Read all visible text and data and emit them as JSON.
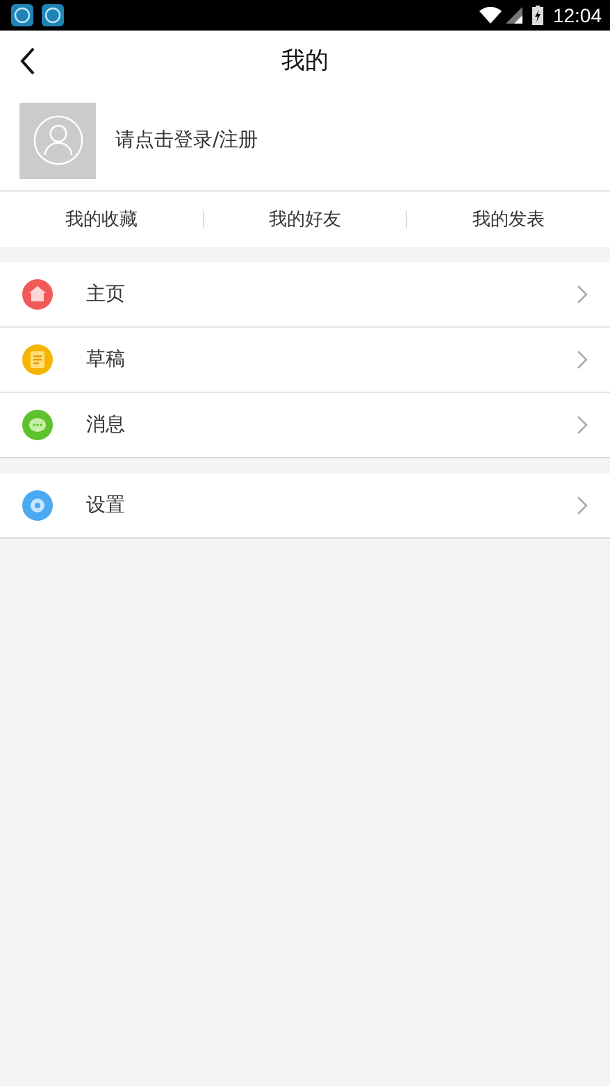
{
  "status_bar": {
    "time": "12:04"
  },
  "header": {
    "title": "我的"
  },
  "profile": {
    "prompt": "请点击登录/注册"
  },
  "tabs": [
    {
      "label": "我的收藏"
    },
    {
      "label": "我的好友"
    },
    {
      "label": "我的发表"
    }
  ],
  "menu_groups": [
    [
      {
        "kind": "home",
        "label": "主页"
      },
      {
        "kind": "draft",
        "label": "草稿"
      },
      {
        "kind": "message",
        "label": "消息"
      }
    ],
    [
      {
        "kind": "settings",
        "label": "设置"
      }
    ]
  ]
}
